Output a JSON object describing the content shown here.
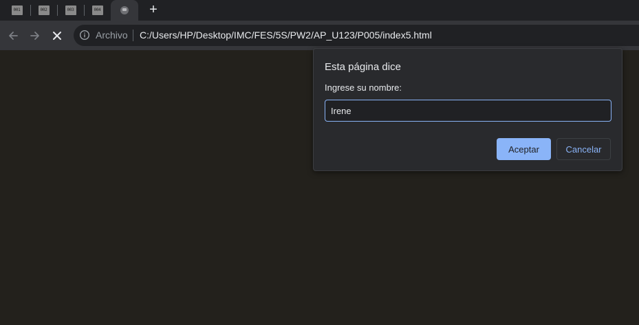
{
  "tabs": [
    {
      "favicon_label": "001"
    },
    {
      "favicon_label": "002"
    },
    {
      "favicon_label": "003"
    },
    {
      "favicon_label": "004"
    },
    {
      "favicon_label": "",
      "active": true
    }
  ],
  "newtab": {
    "label": "+"
  },
  "toolbar": {
    "back_icon": "arrow-left-icon",
    "forward_icon": "arrow-right-icon",
    "stop_icon": "close-icon",
    "security_label": "Archivo",
    "url": "C:/Users/HP/Desktop/IMC/FES/5S/PW2/AP_U123/P005/index5.html"
  },
  "dialog": {
    "title": "Esta página dice",
    "message": "Ingrese su nombre:",
    "input_value": "Irene",
    "accept_label": "Aceptar",
    "cancel_label": "Cancelar"
  },
  "colors": {
    "page_background": "#23211c",
    "accent": "#8ab4f8",
    "dialog_background": "#292a2d"
  }
}
